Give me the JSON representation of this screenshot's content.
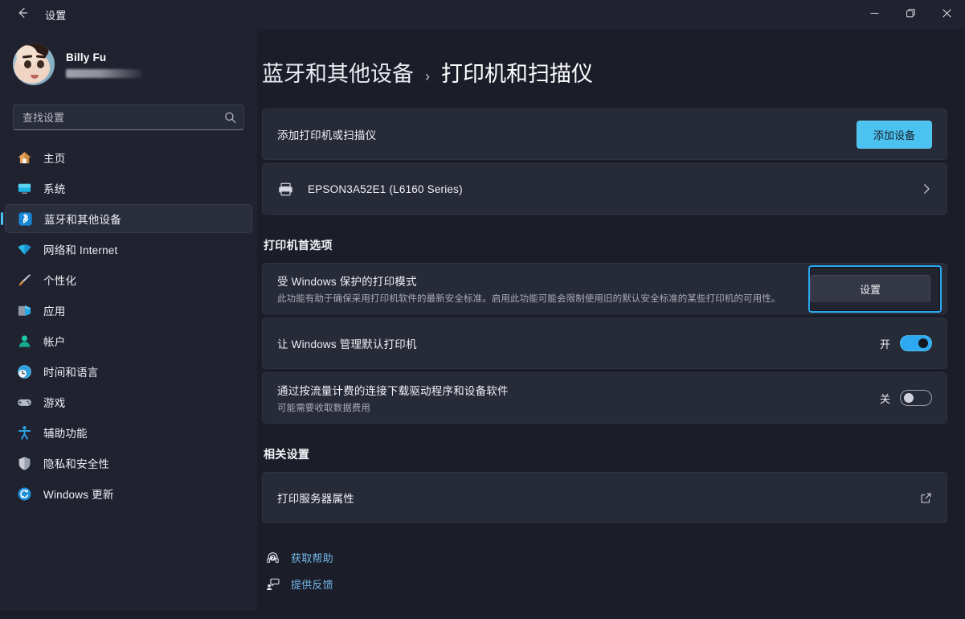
{
  "window": {
    "title": "设置",
    "back_icon": "arrow-left-icon",
    "controls": {
      "minimize": "minimize-icon",
      "maximize": "maximize-icon",
      "close": "close-icon"
    }
  },
  "sidebar": {
    "profile": {
      "name": "Billy Fu",
      "email_redacted": ""
    },
    "search": {
      "placeholder": "查找设置",
      "value": "",
      "icon": "search-icon"
    },
    "items": [
      {
        "label": "主页",
        "icon": "home-icon",
        "selected": false
      },
      {
        "label": "系统",
        "icon": "system-icon",
        "selected": false
      },
      {
        "label": "蓝牙和其他设备",
        "icon": "bluetooth-icon",
        "selected": true
      },
      {
        "label": "网络和 Internet",
        "icon": "network-icon",
        "selected": false
      },
      {
        "label": "个性化",
        "icon": "personalization-icon",
        "selected": false
      },
      {
        "label": "应用",
        "icon": "apps-icon",
        "selected": false
      },
      {
        "label": "帐户",
        "icon": "accounts-icon",
        "selected": false
      },
      {
        "label": "时间和语言",
        "icon": "time-language-icon",
        "selected": false
      },
      {
        "label": "游戏",
        "icon": "gaming-icon",
        "selected": false
      },
      {
        "label": "辅助功能",
        "icon": "accessibility-icon",
        "selected": false
      },
      {
        "label": "隐私和安全性",
        "icon": "privacy-security-icon",
        "selected": false
      },
      {
        "label": "Windows 更新",
        "icon": "windows-update-icon",
        "selected": false
      }
    ]
  },
  "main": {
    "breadcrumb": {
      "parent": "蓝牙和其他设备",
      "separator": "›",
      "current": "打印机和扫描仪"
    },
    "add_printer": {
      "title": "添加打印机或扫描仪",
      "button_label": "添加设备"
    },
    "printer": {
      "name": "EPSON3A52E1 (L6160 Series)",
      "icon": "printer-icon",
      "chevron": "chevron-right-icon"
    },
    "preferences_heading": "打印机首选项",
    "protected_print": {
      "title": "受 Windows 保护的打印模式",
      "description": "此功能有助于确保采用打印机软件的最新安全标准。启用此功能可能会限制使用旧的默认安全标准的某些打印机的可用性。",
      "button_label": "设置",
      "focused": true
    },
    "default_printer": {
      "title": "让 Windows 管理默认打印机",
      "state_label": "开",
      "state": "on"
    },
    "metered_download": {
      "title": "通过按流量计费的连接下载驱动程序和设备软件",
      "description": "可能需要收取数据费用",
      "state_label": "关",
      "state": "off"
    },
    "related_heading": "相关设置",
    "print_server": {
      "title": "打印服务器属性",
      "icon": "external-link-icon"
    },
    "links": [
      {
        "label": "获取帮助",
        "icon": "help-headset-icon"
      },
      {
        "label": "提供反馈",
        "icon": "feedback-icon"
      }
    ]
  },
  "colors": {
    "accent": "#4cc2f1",
    "toggle_on": "#2ea8f0",
    "focus_ring": "#29a9f0",
    "link": "#73b8e8",
    "page_bg": "#1b1d29",
    "card_bg": "#272a37",
    "sidebar_bg": "#202230"
  }
}
